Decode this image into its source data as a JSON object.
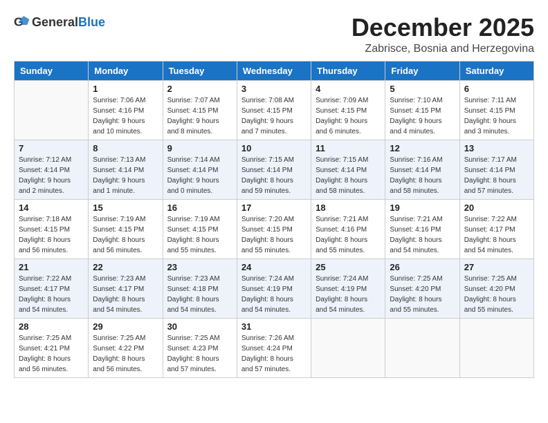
{
  "logo": {
    "general": "General",
    "blue": "Blue"
  },
  "header": {
    "month": "December 2025",
    "location": "Zabrisce, Bosnia and Herzegovina"
  },
  "weekdays": [
    "Sunday",
    "Monday",
    "Tuesday",
    "Wednesday",
    "Thursday",
    "Friday",
    "Saturday"
  ],
  "weeks": [
    [
      {
        "day": "",
        "info": ""
      },
      {
        "day": "1",
        "info": "Sunrise: 7:06 AM\nSunset: 4:16 PM\nDaylight: 9 hours\nand 10 minutes."
      },
      {
        "day": "2",
        "info": "Sunrise: 7:07 AM\nSunset: 4:15 PM\nDaylight: 9 hours\nand 8 minutes."
      },
      {
        "day": "3",
        "info": "Sunrise: 7:08 AM\nSunset: 4:15 PM\nDaylight: 9 hours\nand 7 minutes."
      },
      {
        "day": "4",
        "info": "Sunrise: 7:09 AM\nSunset: 4:15 PM\nDaylight: 9 hours\nand 6 minutes."
      },
      {
        "day": "5",
        "info": "Sunrise: 7:10 AM\nSunset: 4:15 PM\nDaylight: 9 hours\nand 4 minutes."
      },
      {
        "day": "6",
        "info": "Sunrise: 7:11 AM\nSunset: 4:15 PM\nDaylight: 9 hours\nand 3 minutes."
      }
    ],
    [
      {
        "day": "7",
        "info": "Sunrise: 7:12 AM\nSunset: 4:14 PM\nDaylight: 9 hours\nand 2 minutes."
      },
      {
        "day": "8",
        "info": "Sunrise: 7:13 AM\nSunset: 4:14 PM\nDaylight: 9 hours\nand 1 minute."
      },
      {
        "day": "9",
        "info": "Sunrise: 7:14 AM\nSunset: 4:14 PM\nDaylight: 9 hours\nand 0 minutes."
      },
      {
        "day": "10",
        "info": "Sunrise: 7:15 AM\nSunset: 4:14 PM\nDaylight: 8 hours\nand 59 minutes."
      },
      {
        "day": "11",
        "info": "Sunrise: 7:15 AM\nSunset: 4:14 PM\nDaylight: 8 hours\nand 58 minutes."
      },
      {
        "day": "12",
        "info": "Sunrise: 7:16 AM\nSunset: 4:14 PM\nDaylight: 8 hours\nand 58 minutes."
      },
      {
        "day": "13",
        "info": "Sunrise: 7:17 AM\nSunset: 4:14 PM\nDaylight: 8 hours\nand 57 minutes."
      }
    ],
    [
      {
        "day": "14",
        "info": "Sunrise: 7:18 AM\nSunset: 4:15 PM\nDaylight: 8 hours\nand 56 minutes."
      },
      {
        "day": "15",
        "info": "Sunrise: 7:19 AM\nSunset: 4:15 PM\nDaylight: 8 hours\nand 56 minutes."
      },
      {
        "day": "16",
        "info": "Sunrise: 7:19 AM\nSunset: 4:15 PM\nDaylight: 8 hours\nand 55 minutes."
      },
      {
        "day": "17",
        "info": "Sunrise: 7:20 AM\nSunset: 4:15 PM\nDaylight: 8 hours\nand 55 minutes."
      },
      {
        "day": "18",
        "info": "Sunrise: 7:21 AM\nSunset: 4:16 PM\nDaylight: 8 hours\nand 55 minutes."
      },
      {
        "day": "19",
        "info": "Sunrise: 7:21 AM\nSunset: 4:16 PM\nDaylight: 8 hours\nand 54 minutes."
      },
      {
        "day": "20",
        "info": "Sunrise: 7:22 AM\nSunset: 4:17 PM\nDaylight: 8 hours\nand 54 minutes."
      }
    ],
    [
      {
        "day": "21",
        "info": "Sunrise: 7:22 AM\nSunset: 4:17 PM\nDaylight: 8 hours\nand 54 minutes."
      },
      {
        "day": "22",
        "info": "Sunrise: 7:23 AM\nSunset: 4:17 PM\nDaylight: 8 hours\nand 54 minutes."
      },
      {
        "day": "23",
        "info": "Sunrise: 7:23 AM\nSunset: 4:18 PM\nDaylight: 8 hours\nand 54 minutes."
      },
      {
        "day": "24",
        "info": "Sunrise: 7:24 AM\nSunset: 4:19 PM\nDaylight: 8 hours\nand 54 minutes."
      },
      {
        "day": "25",
        "info": "Sunrise: 7:24 AM\nSunset: 4:19 PM\nDaylight: 8 hours\nand 54 minutes."
      },
      {
        "day": "26",
        "info": "Sunrise: 7:25 AM\nSunset: 4:20 PM\nDaylight: 8 hours\nand 55 minutes."
      },
      {
        "day": "27",
        "info": "Sunrise: 7:25 AM\nSunset: 4:20 PM\nDaylight: 8 hours\nand 55 minutes."
      }
    ],
    [
      {
        "day": "28",
        "info": "Sunrise: 7:25 AM\nSunset: 4:21 PM\nDaylight: 8 hours\nand 56 minutes."
      },
      {
        "day": "29",
        "info": "Sunrise: 7:25 AM\nSunset: 4:22 PM\nDaylight: 8 hours\nand 56 minutes."
      },
      {
        "day": "30",
        "info": "Sunrise: 7:25 AM\nSunset: 4:23 PM\nDaylight: 8 hours\nand 57 minutes."
      },
      {
        "day": "31",
        "info": "Sunrise: 7:26 AM\nSunset: 4:24 PM\nDaylight: 8 hours\nand 57 minutes."
      },
      {
        "day": "",
        "info": ""
      },
      {
        "day": "",
        "info": ""
      },
      {
        "day": "",
        "info": ""
      }
    ]
  ]
}
